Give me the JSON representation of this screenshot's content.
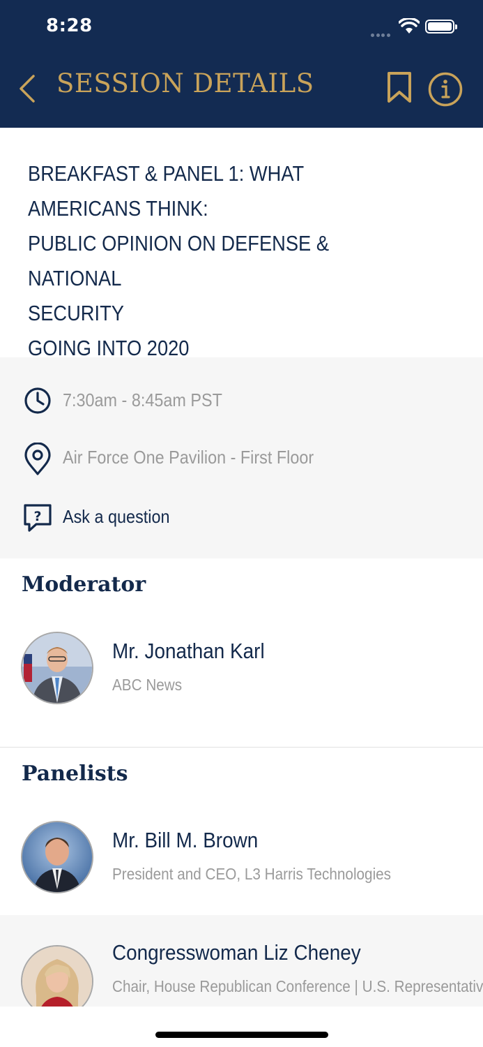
{
  "status_bar": {
    "time": "8:28"
  },
  "header": {
    "title": "SESSION DETAILS"
  },
  "session": {
    "title": "BREAKFAST & PANEL 1: WHAT AMERICANS THINK:\nPUBLIC OPINION ON DEFENSE & NATIONAL\nSECURITY\nGOING INTO 2020"
  },
  "info": {
    "time": "7:30am - 8:45am PST",
    "location": "Air Force One Pavilion - First Floor",
    "ask": "Ask a question"
  },
  "moderator": {
    "heading": "Moderator",
    "name": "Mr. Jonathan Karl",
    "org": "ABC News"
  },
  "panelists": {
    "heading": "Panelists",
    "items": [
      {
        "name": "Mr. Bill M. Brown",
        "org": "President and CEO, L3 Harris Technologies"
      },
      {
        "name": "Congresswoman Liz Cheney",
        "org": "Chair, House Republican Conference | U.S. Representative,"
      }
    ]
  },
  "colors": {
    "navy": "#132b52",
    "gold": "#c9a35a",
    "text_navy": "#13294b",
    "gray_text": "#9a9a9a",
    "panel_bg": "#f6f6f6"
  }
}
